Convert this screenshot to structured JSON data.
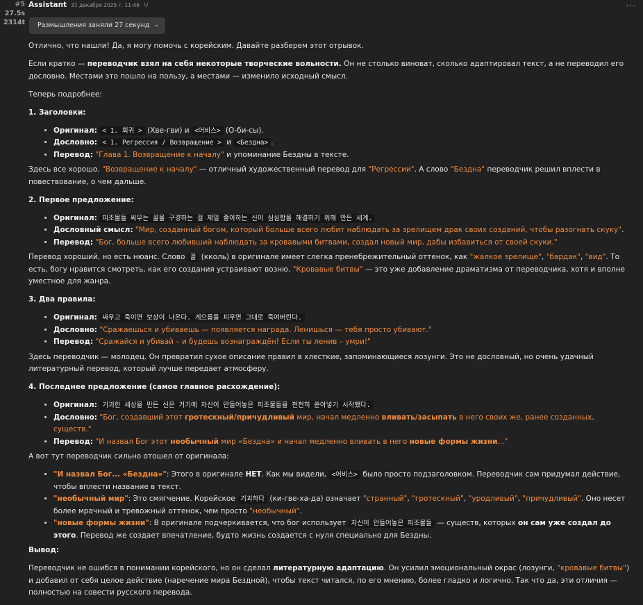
{
  "meta": {
    "msg_no": "#5",
    "time": "27.5s",
    "tokens": "2314t"
  },
  "header": {
    "author": "Assistant",
    "timestamp": "31 декабря 2025 г. 11:46",
    "branch_icon": "branch-icon",
    "more_icon": "more-horizontal-icon"
  },
  "thinking": {
    "label": "Размышления заняли 27 секунд",
    "icon": "chevron-down-icon"
  },
  "body": {
    "p1": "Отлично, что нашли! Да, я могу помочь с корейским. Давайте разберем этот отрывок.",
    "p2a": "Если кратко — ",
    "p2b": "переводчик взял на себя некоторые творческие вольности.",
    "p2c": " Он не столько виноват, сколько адаптировал текст, а не переводил его дословно. Местами это пошло на пользу, а местами — изменило исходный смысл.",
    "p3": "Теперь подробнее:",
    "s1": {
      "heading": "1. Заголовки:",
      "items": [
        {
          "label": "Оригинал:",
          "code1": "< 1. 회귀 >",
          "t1": " (Хве-гви) и ",
          "code2": "<어비스>",
          "t2": " (О-би-сы)."
        },
        {
          "label": "Дословно:",
          "code1": "< 1. Регрессия / Возвращение >",
          "t1": " и ",
          "code2": "<Бездна>",
          "t2": "."
        },
        {
          "label": "Перевод:",
          "o1": "\"Глава 1. Возвращение к началу\"",
          "t1": " и упоминание Бездны в тексте."
        }
      ],
      "c1": "Здесь все хорошо. ",
      "co1": "\"Возвращение к началу\"",
      "c2": " — отличный художественный перевод для ",
      "co2": "\"Регрессии\"",
      "c3": ". А слово ",
      "co3": "\"Бездна\"",
      "c4": " переводчик решил вплести в повествование, о чем дальше."
    },
    "s2": {
      "heading": "2. Первое предложение:",
      "items": [
        {
          "label": "Оригинал:",
          "code1": "피조물들 싸우는 꼴을 구경하는 걸 제일 좋아하는 신이 심심함을 해결하기 위해 만든 세계."
        },
        {
          "label": "Дословный смысл:",
          "o1": "\"Мир, созданный богом, который больше всего любит наблюдать за зрелищем драк своих созданий, чтобы разогнать скуку\"",
          "t1": "."
        },
        {
          "label": "Перевод:",
          "o1": "\"Бог, больше всего любивший наблюдать за кровавыми битвами, создал новый мир, дабы избавиться от своей скуки.\""
        }
      ],
      "c1": "Перевод хороший, но есть нюанс. Слово ",
      "ccode": "꼴",
      "c2": " (кколь) в оригинале имеет слегка пренебрежительный оттенок, как ",
      "co1": "\"жалкое зрелище\"",
      "c3": ", ",
      "co2": "\"бардак\"",
      "c4": ", ",
      "co3": "\"вид\"",
      "c5": ". То есть, богу нравится смотреть, как его создания устраивают возню. ",
      "co4": "\"Кровавые битвы\"",
      "c6": " — это уже добавление драматизма от переводчика, хотя и вполне уместное для жанра."
    },
    "s3": {
      "heading": "3. Два правила:",
      "items": [
        {
          "label": "Оригинал:",
          "code1": "싸우고 죽이면 보상이 나온다. 게으름을 피우면 그대로 죽여버린다."
        },
        {
          "label": "Дословно:",
          "o1": "\"Сражаешься и убиваешь — появляется награда. Ленишься — тебя просто убивают.\""
        },
        {
          "label": "Перевод:",
          "o1": "\"Сражайся и убивай – и будешь вознаграждён! Если ты ленив – умри!\""
        }
      ],
      "comment": "Здесь переводчик — молодец. Он превратил сухое описание правил в хлесткие, запоминающиеся лозунги. Это не дословный, но очень удачный литературный перевод, который лучше передает атмосферу."
    },
    "s4": {
      "heading": "4. Последнее предложение (самое главное расхождение):",
      "items": [
        {
          "label": "Оригинал:",
          "code1": "기괴한 세상을 만든 신은 거기에 자신이 만들어놓은 피조물들을 천천히 쏟아넣기 시작했다."
        },
        {
          "label": "Дословно:",
          "o1": "\"Бог, создавший этот ",
          "ob1": "гротескный/причудливый",
          "o2": " мир, начал медленно ",
          "ob2": "вливать/засыпать",
          "o3": " в него своих же, ранее созданных, существ.\""
        },
        {
          "label": "Перевод:",
          "o1": "\"И назвал Бог этот ",
          "ob1": "необычный",
          "o2": " мир «Бездна» и начал медленно вливать в него ",
          "ob2": "новые формы жизни",
          "o3": "...\""
        }
      ],
      "intro": "А вот тут переводчик сильно отошел от оригинала:"
    },
    "diffs": [
      {
        "ob": "\"И назвал Бог... «Бездна»\"",
        "t1": ": Этого в оригинале ",
        "b1": "НЕТ",
        "t2": ". Как мы видели, ",
        "code1": "<어비스>",
        "t3": " было просто подзаголовком. Переводчик сам придумал действие, чтобы вплести название в текст."
      },
      {
        "ob": "\"необычный мир\"",
        "t1": ": Это смягчение. Корейское ",
        "code1": "기괴하다",
        "t2": " (ки-гве-ха-да) означает ",
        "o1": "\"странный\"",
        "s1": ", ",
        "o2": "\"гротескный\"",
        "s2": ", ",
        "o3": "\"уродливый\"",
        "s3": ", ",
        "o4": "\"причудливый\"",
        "t3": ". Оно несет более мрачный и тревожный оттенок, чем просто ",
        "o5": "\"необычный\"",
        "t4": "."
      },
      {
        "ob": "\"новые формы жизни\"",
        "t1": ": В оригинале подчеркивается, что бог использует ",
        "code1": "자신이 만들어놓은 피조물들",
        "t2": " — существ, которых ",
        "b1": "он сам уже создал до этого",
        "t3": ". Перевод же создает впечатление, будто жизнь создается с нуля специально для Бездны."
      }
    ],
    "conclusion": {
      "heading": "Вывод:",
      "t1": "Переводчик не ошибся в понимании корейского, но он сделал ",
      "b1": "литературную адаптацию",
      "t2": ". Он усилил эмоциональный окрас (лозунги, ",
      "o1": "\"кровавые битвы\"",
      "t3": ") и добавил от себя целое действие (наречение мира Бездной), чтобы текст читался, по его мнению, более гладко и логично. Так что да, эти отличия — полностью на совести русского перевода."
    }
  }
}
